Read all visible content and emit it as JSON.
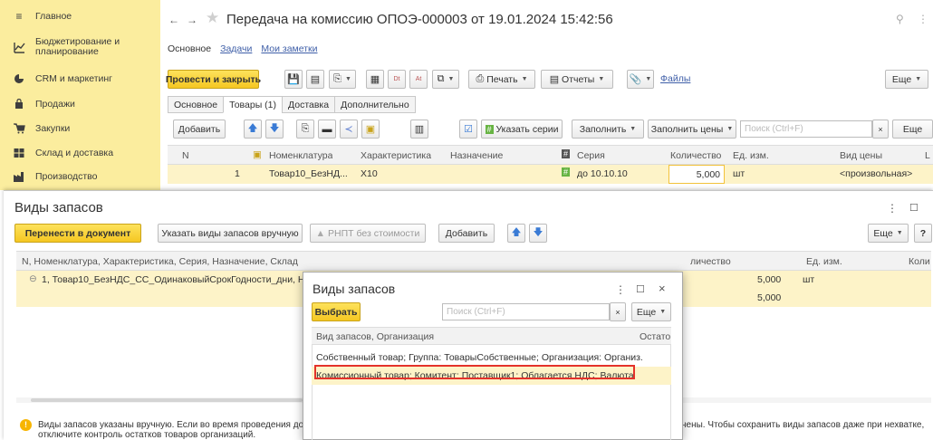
{
  "sidebar": {
    "items": [
      {
        "label": "Главное",
        "icon": "menu-icon"
      },
      {
        "label": "Бюджетирование и планирование",
        "icon": "chart-icon"
      },
      {
        "label": "CRM и маркетинг",
        "icon": "crm-icon"
      },
      {
        "label": "Продажи",
        "icon": "cart-icon"
      },
      {
        "label": "Закупки",
        "icon": "basket-icon"
      },
      {
        "label": "Склад и доставка",
        "icon": "warehouse-icon"
      },
      {
        "label": "Производство",
        "icon": "factory-icon"
      }
    ]
  },
  "document": {
    "title": "Передача на комиссию ОПОЭ-000003 от 19.01.2024 15:42:56",
    "tabs": [
      "Основное",
      "Задачи",
      "Мои заметки"
    ],
    "toolbar": {
      "post_close": "Провести и закрыть",
      "print": "Печать",
      "reports": "Отчеты",
      "files": "Файлы",
      "more": "Еще"
    },
    "subtabs": [
      "Основное",
      "Товары (1)",
      "Доставка",
      "Дополнительно"
    ],
    "goods_toolbar": {
      "add": "Добавить",
      "series": "Указать серии",
      "fill": "Заполнить",
      "fill_prices": "Заполнить цены",
      "search_placeholder": "Поиск (Ctrl+F)",
      "more": "Еще"
    },
    "columns": [
      "N",
      "Номенклатура",
      "Характеристика",
      "Назначение",
      "Серия",
      "Количество",
      "Ед. изм.",
      "Вид цены",
      "L"
    ],
    "row": {
      "n": "1",
      "item": "Товар10_БезНД...",
      "characteristic": "X10",
      "purpose": "",
      "series": "до 10.10.10",
      "quantity": "5,000",
      "unit": "шт",
      "price_type": "<произвольная>"
    }
  },
  "stock_panel": {
    "title": "Виды запасов",
    "buttons": {
      "transfer": "Перенести в документ",
      "manual": "Указать виды запасов вручную",
      "rnpt": "РНПТ без стоимости",
      "add": "Добавить",
      "more": "Еще",
      "help": "?"
    },
    "header": {
      "main": "N, Номенклатура, Характеристика, Серия, Назначение, Склад",
      "qty": "личество",
      "unit": "Ед. изм.",
      "qty2": "Коли"
    },
    "row1": {
      "text": "1, Товар10_БезНДС_СС_ОдинаковыйСрокГодности_дни, Не го",
      "qty": "5,000",
      "unit": "шт"
    },
    "row2": {
      "qty": "5,000"
    },
    "warning": {
      "left": "Виды запасов указаны вручную. Если во время проведения до",
      "right": "нены. Чтобы сохранить виды запасов даже при нехватке,",
      "line2": "отключите контроль остатков товаров организаций."
    }
  },
  "popup": {
    "title": "Виды запасов",
    "select": "Выбрать",
    "search_placeholder": "Поиск (Ctrl+F)",
    "more": "Еще",
    "header": {
      "main": "Вид запасов, Организация",
      "rest": "Остато"
    },
    "rows": [
      "Собственный товар; Группа: ТоварыСобственные; Организация: Организ...",
      "Комиссионный товар; Комитент: Поставщик1; Облагается НДС; Валюта: ..."
    ]
  }
}
